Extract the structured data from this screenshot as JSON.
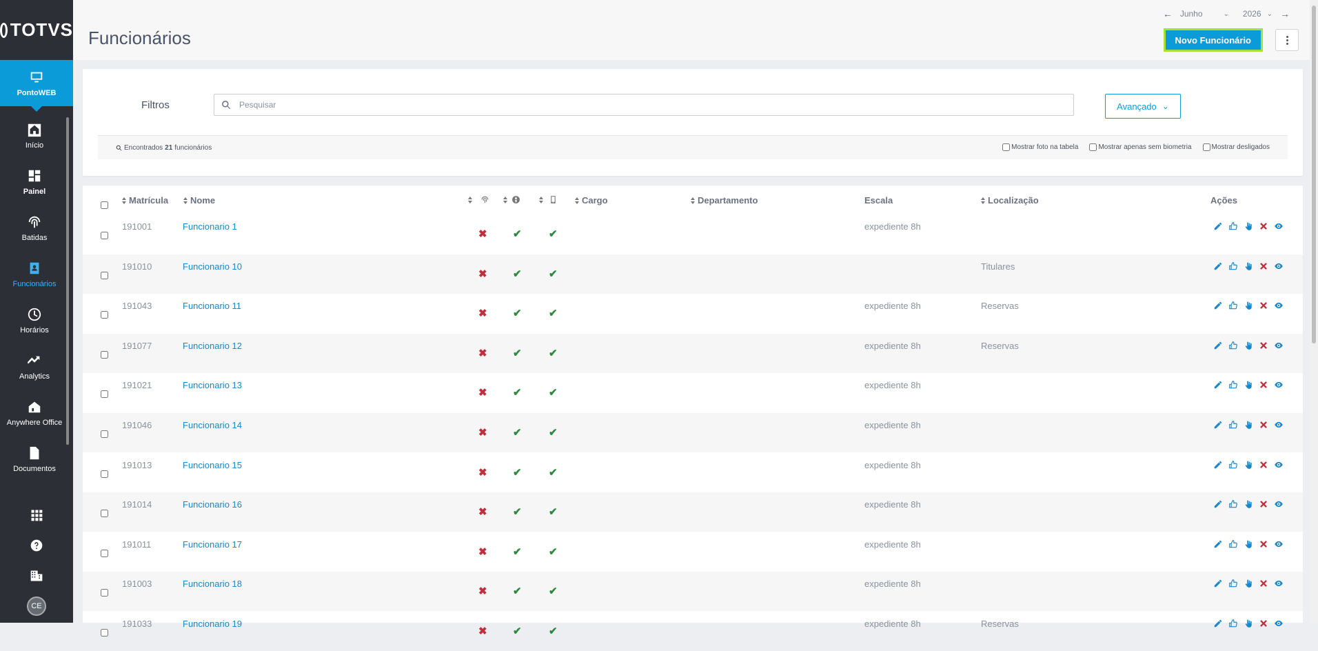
{
  "brand": "TOTVS",
  "product": "PontoWEB",
  "nav": [
    {
      "label": "Início",
      "icon": "home-icon"
    },
    {
      "label": "Painel",
      "icon": "dashboard-icon"
    },
    {
      "label": "Batidas",
      "icon": "fingerprint-icon"
    },
    {
      "label": "Funcionários",
      "icon": "badge-icon"
    },
    {
      "label": "Horários",
      "icon": "clock-icon"
    },
    {
      "label": "Analytics",
      "icon": "trend-icon"
    },
    {
      "label": "Anywhere Office",
      "icon": "home-office-icon"
    },
    {
      "label": "Documentos",
      "icon": "document-icon"
    }
  ],
  "user_initials": "CE",
  "header": {
    "title": "Funcionários",
    "month": "Junho",
    "year": "2026",
    "new_button": "Novo Funcionário"
  },
  "filters": {
    "label": "Filtros",
    "search_placeholder": "Pesquisar",
    "advanced": "Avançado",
    "found_prefix": "Encontrados",
    "found_count": "21",
    "found_suffix": "funcionários",
    "opt_photo": "Mostrar foto na tabela",
    "opt_biometry": "Mostrar apenas sem biometria",
    "opt_dismissed": "Mostrar desligados"
  },
  "columns": {
    "matricula": "Matrícula",
    "nome": "Nome",
    "cargo": "Cargo",
    "departamento": "Departamento",
    "escala": "Escala",
    "localizacao": "Localização",
    "acoes": "Ações"
  },
  "colors": {
    "accent": "#0c9bd9",
    "link": "#1a87c7",
    "danger": "#c0303c",
    "success": "#2b8a3e"
  },
  "rows": [
    {
      "matricula": "191001",
      "nome": "Funcionario 1",
      "escala": "expediente 8h",
      "localizacao": ""
    },
    {
      "matricula": "191010",
      "nome": "Funcionario 10",
      "escala": "",
      "localizacao": "Titulares"
    },
    {
      "matricula": "191043",
      "nome": "Funcionario 11",
      "escala": "expediente 8h",
      "localizacao": "Reservas"
    },
    {
      "matricula": "191077",
      "nome": "Funcionario 12",
      "escala": "expediente 8h",
      "localizacao": "Reservas"
    },
    {
      "matricula": "191021",
      "nome": "Funcionario 13",
      "escala": "expediente 8h",
      "localizacao": ""
    },
    {
      "matricula": "191046",
      "nome": "Funcionario 14",
      "escala": "expediente 8h",
      "localizacao": ""
    },
    {
      "matricula": "191013",
      "nome": "Funcionario 15",
      "escala": "expediente 8h",
      "localizacao": ""
    },
    {
      "matricula": "191014",
      "nome": "Funcionario 16",
      "escala": "expediente 8h",
      "localizacao": ""
    },
    {
      "matricula": "191011",
      "nome": "Funcionario 17",
      "escala": "expediente 8h",
      "localizacao": ""
    },
    {
      "matricula": "191003",
      "nome": "Funcionario 18",
      "escala": "expediente 8h",
      "localizacao": ""
    },
    {
      "matricula": "191033",
      "nome": "Funcionario 19",
      "escala": "expediente 8h",
      "localizacao": "Reservas"
    }
  ]
}
